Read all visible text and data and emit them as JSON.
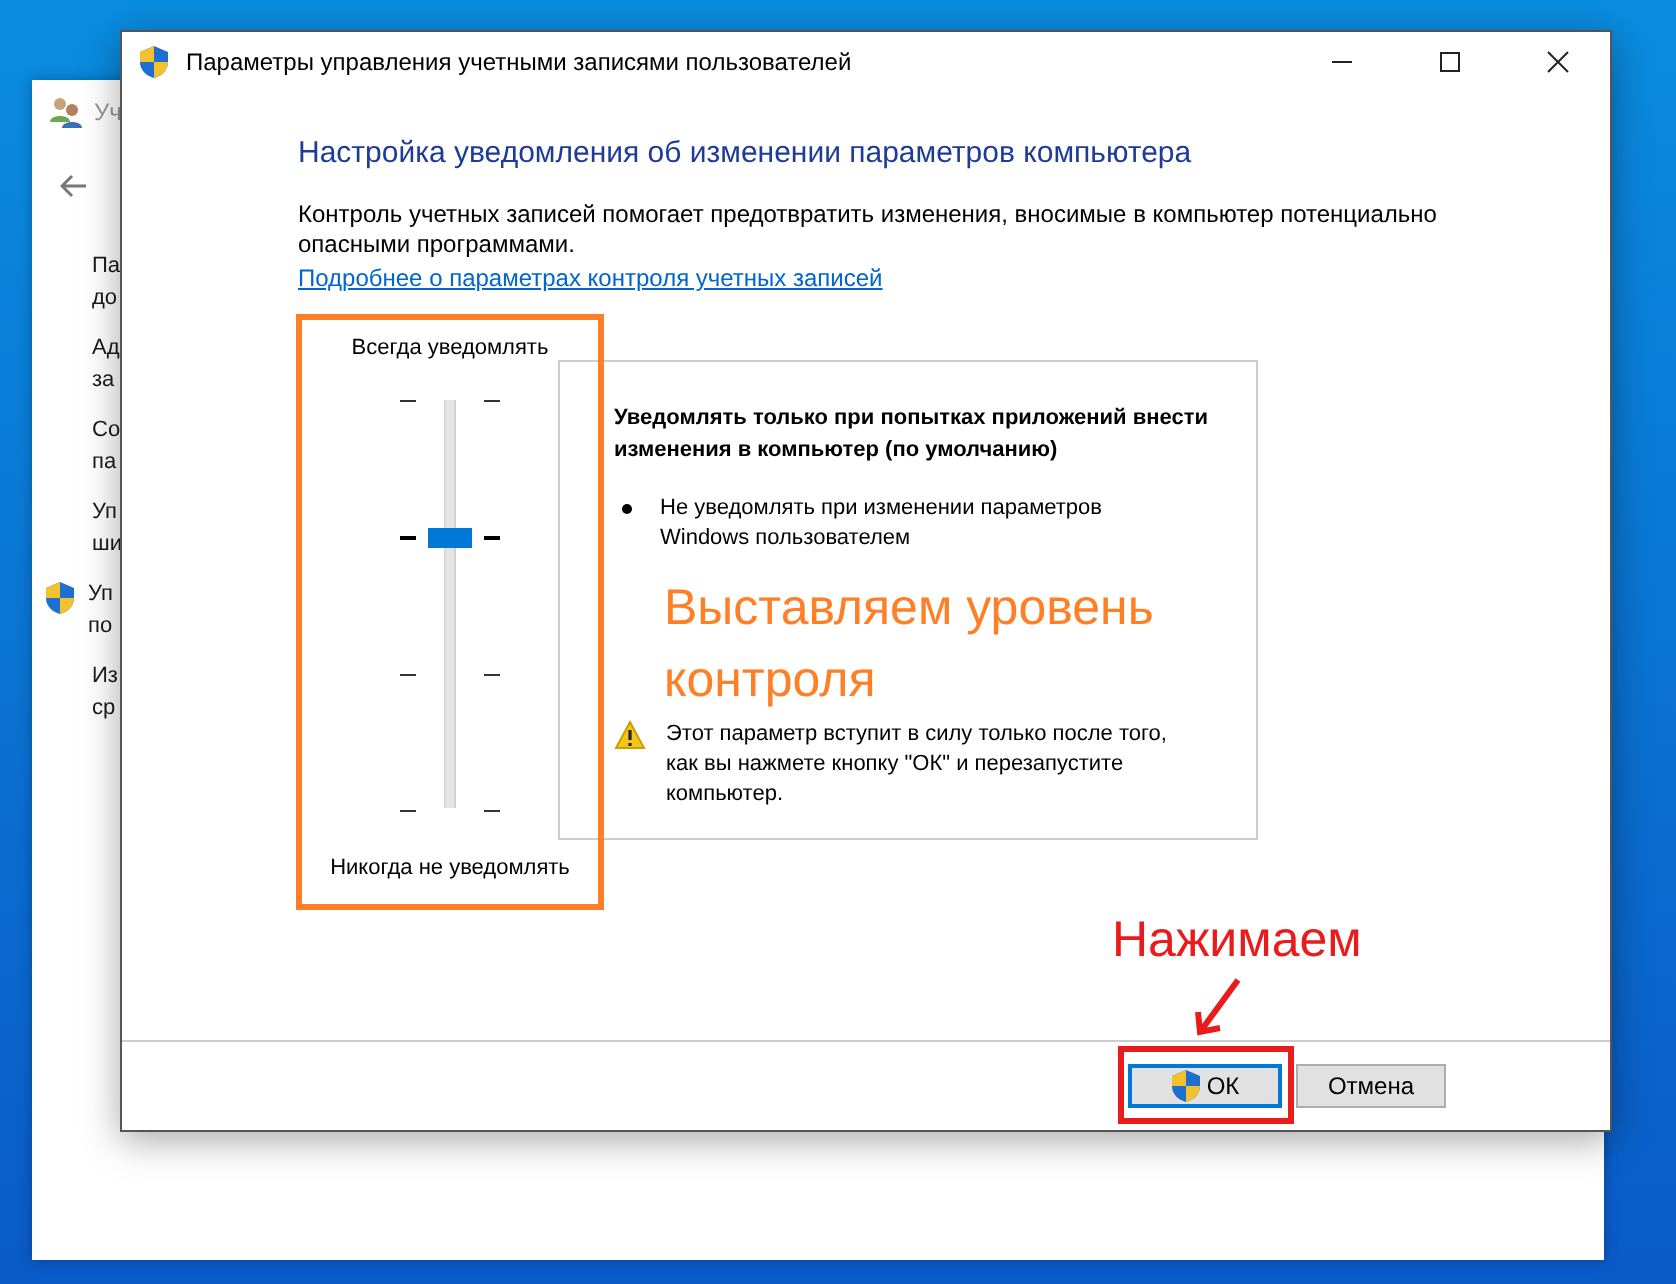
{
  "background_window": {
    "title": "Уч",
    "items": [
      {
        "lines": [
          "Па",
          "до"
        ],
        "shield": false
      },
      {
        "lines": [
          "Ад",
          "за"
        ],
        "shield": false
      },
      {
        "lines": [
          "Со",
          "па"
        ],
        "shield": false
      },
      {
        "lines": [
          "Уп",
          "ши"
        ],
        "shield": false
      },
      {
        "lines": [
          "Уп",
          "по"
        ],
        "shield": true
      },
      {
        "lines": [
          "Из",
          "ср"
        ],
        "shield": false
      }
    ]
  },
  "window": {
    "title": "Параметры управления учетными записями пользователей"
  },
  "heading": "Настройка уведомления об изменении параметров компьютера",
  "description": "Контроль учетных записей помогает предотвратить изменения, вносимые в компьютер потенциально опасными программами.",
  "link": "Подробнее о параметрах контроля учетных записей",
  "slider": {
    "top_label": "Всегда уведомлять",
    "bottom_label": "Никогда не уведомлять",
    "level": 0.667
  },
  "info": {
    "title": "Уведомлять только при попытках приложений внести изменения в компьютер (по умолчанию)",
    "bullets": [
      "Не уведомлять при изменении параметров Windows пользователем"
    ],
    "warning": "Этот параметр вступит в силу только после того, как вы нажмете кнопку \"ОК\" и перезапустите компьютер."
  },
  "buttons": [
    {
      "label": "ОК",
      "kind": "primary"
    },
    {
      "label": "Отмена",
      "kind": "normal"
    }
  ],
  "annotations": {
    "slider_note": "Выставляем уровень контроля",
    "button_note": "Нажимаем"
  }
}
